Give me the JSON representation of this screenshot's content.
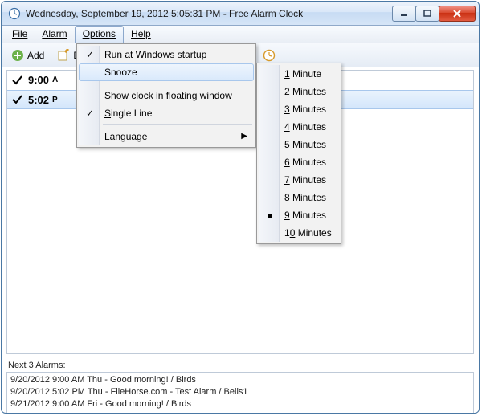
{
  "titlebar": {
    "title": "Wednesday, September 19, 2012 5:05:31 PM - Free Alarm Clock"
  },
  "menubar": {
    "file": "File",
    "alarm": "Alarm",
    "options": "Options",
    "help": "Help"
  },
  "toolbar": {
    "add": "Add",
    "edit_prefix": "E"
  },
  "alarms": [
    {
      "time": "9:00",
      "ampm": "A",
      "selected": false
    },
    {
      "time": "5:02",
      "ampm": "P",
      "selected": true
    }
  ],
  "options_menu": {
    "run_startup": "Run at Windows startup",
    "snooze": "Snooze",
    "float": "Show clock in floating window",
    "single_line": "Single Line",
    "language": "Language"
  },
  "snooze_menu": {
    "m1": "1 Minute",
    "m2": "2 Minutes",
    "m3": "3 Minutes",
    "m4": "4 Minutes",
    "m5": "5 Minutes",
    "m6": "6 Minutes",
    "m7": "7 Minutes",
    "m8": "8 Minutes",
    "m9": "9 Minutes",
    "m10_a": "1",
    "m10_b": "0 Minutes"
  },
  "bottom": {
    "label": "Next 3 Alarms:",
    "lines": [
      "9/20/2012 9:00 AM Thu - Good morning! / Birds",
      "9/20/2012 5:02 PM Thu - FileHorse.com - Test Alarm / Bells1",
      "9/21/2012 9:00 AM Fri - Good morning! / Birds"
    ]
  }
}
